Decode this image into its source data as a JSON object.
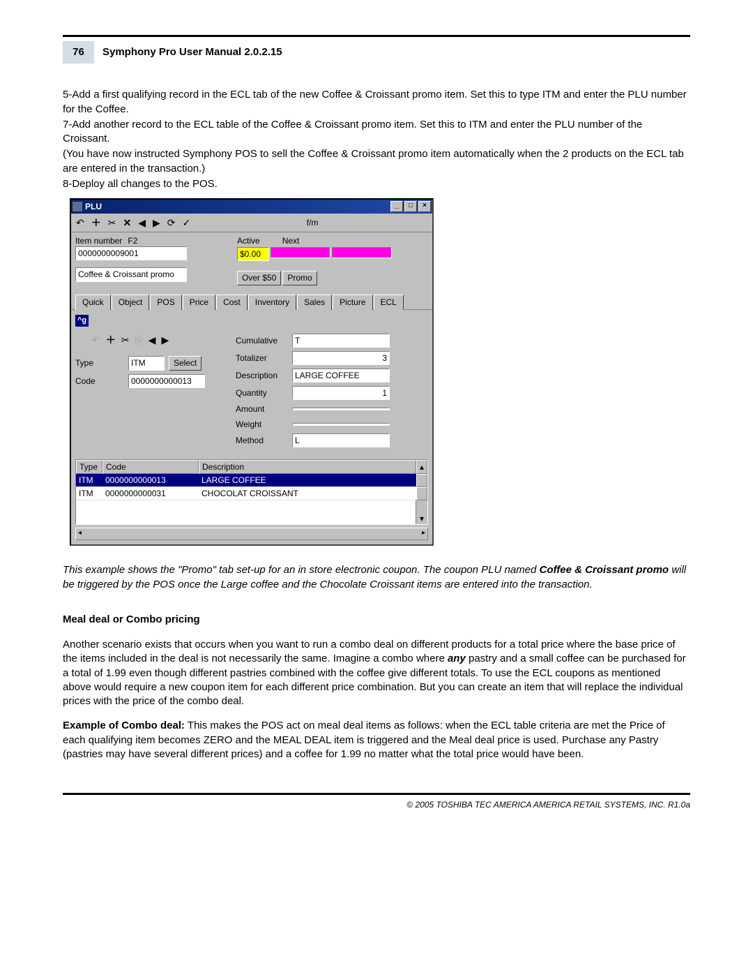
{
  "header": {
    "page_num": "76",
    "title": "Symphony Pro User Manual  2.0.2.15"
  },
  "instructions": {
    "p1": " 5-Add a first qualifying record in the ECL tab of the new Coffee & Croissant promo item. Set this to type ITM and enter the PLU number for the Coffee.",
    "p2": " 7-Add another record to the ECL table of the Coffee & Croissant promo item. Set this to ITM and enter the PLU number of the Croissant.",
    "p3": "  (You have now instructed Symphony POS to sell the Coffee & Croissant promo item automatically when the 2 products on the ECL tab are entered in the transaction.)",
    "p4": " 8-Deploy all changes to the POS."
  },
  "window": {
    "title": "PLU",
    "toolbar_fm": "f/m",
    "item_number_label": "Item number",
    "f2": "F2",
    "item_number": "0000000009001",
    "item_name": "Coffee & Croissant promo",
    "active_label": "Active",
    "next_label": "Next",
    "price_value": "$0.00",
    "over50_label": "Over $50",
    "promo_label": "Promo",
    "tabs": [
      "Quick",
      "Object",
      "POS",
      "Price",
      "Cost",
      "Inventory",
      "Sales",
      "Picture",
      "ECL"
    ],
    "active_tab": "ECL",
    "sub_badge": "^g",
    "type_label": "Type",
    "type_value": "ITM",
    "select_label": "Select",
    "code_label": "Code",
    "code_value": "0000000000013",
    "cumulative_label": "Cumulative",
    "cumulative_value": "T",
    "totalizer_label": "Totalizer",
    "totalizer_value": "3",
    "description_label": "Description",
    "description_value": "LARGE COFFEE",
    "quantity_label": "Quantity",
    "quantity_value": "1",
    "amount_label": "Amount",
    "amount_value": "",
    "weight_label": "Weight",
    "weight_value": "",
    "method_label": "Method",
    "method_value": "L",
    "grid": {
      "headers": {
        "type": "Type",
        "code": "Code",
        "desc": "Description"
      },
      "rows": [
        {
          "type": "ITM",
          "code": "0000000000013",
          "desc": "LARGE COFFEE",
          "selected": true
        },
        {
          "type": "ITM",
          "code": "0000000000031",
          "desc": "CHOCOLAT CROISSANT",
          "selected": false
        }
      ]
    }
  },
  "caption": {
    "l1": "This example shows the \"Promo\" tab set-up for an in store electronic coupon. The coupon PLU named ",
    "bold": "Coffee & Croissant promo",
    "l2": "   will be triggered by the POS once the Large coffee and the Chocolate Croissant items are entered into the transaction."
  },
  "section": {
    "heading": "Meal deal or Combo pricing",
    "p1a": " Another scenario exists that occurs when you want to run a  combo deal on different products for a total price where the base price of the items included in the deal is not necessarily the same. Imagine a combo where ",
    "bold1": "any",
    "p1b": "   pastry and a small coffee can be purchased for a total of 1.99 even though different pastries combined with the coffee give different totals. To use the ECL coupons as mentioned above would require a new coupon item for each different price combination. But you can create an item that will replace the individual prices with the price of the combo deal.",
    "p2_bold": "Example of Combo deal:",
    "p2": " This makes the POS act on meal deal items as follows: when the ECL table criteria are met the Price of each qualifying item becomes ZERO and the MEAL DEAL item is triggered and the Meal deal price is used. Purchase any Pastry (pastries may have several different prices) and a coffee for 1.99 no matter what the total price would have been."
  },
  "footer": "© 2005 TOSHIBA TEC AMERICA AMERICA RETAIL SYSTEMS, INC.   R1.0a"
}
